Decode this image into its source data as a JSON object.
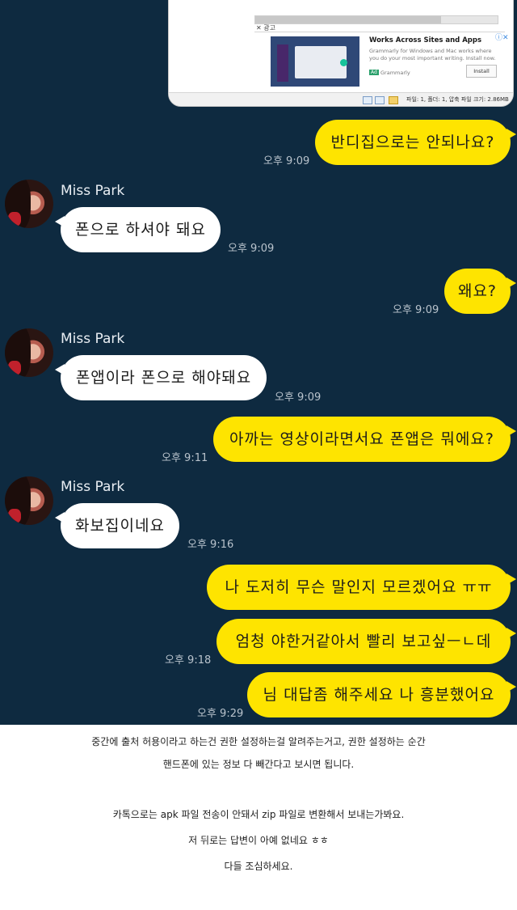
{
  "screenshot_window": {
    "ad_close_label": "✕ 광고",
    "ad_title": "Works Across Sites and Apps",
    "ad_info_icon": "info-close-icon",
    "ad_desc": "Grammarly for Windows and Mac works where you do your most important writing. Install now.",
    "ad_badge": "Ad",
    "ad_brand": "Grammarly",
    "ad_button": "Install",
    "status_text": "파일: 1, 폴더: 1, 압축 파일 크기: 2.86MB"
  },
  "chat": {
    "messages": [
      {
        "text": "반디집으로는 안되나요?",
        "time": "오후 9:09"
      },
      {
        "sender": "Miss Park",
        "text": "폰으로 하셔야 돼요",
        "time": "오후 9:09"
      },
      {
        "text": "왜요?",
        "time": "오후 9:09"
      },
      {
        "sender": "Miss Park",
        "text": "폰앱이라 폰으로 해야돼요",
        "time": "오후 9:09"
      },
      {
        "text": "아까는 영상이라면서요 폰앱은 뭐에요?",
        "time": "오후 9:11"
      },
      {
        "sender": "Miss Park",
        "text": "화보집이네요",
        "time": "오후 9:16"
      },
      {
        "text": "나 도저히 무슨 말인지 모르겠어요 ㅠㅠ"
      },
      {
        "text": "엄청 야한거같아서 빨리 보고싶ㅡㄴ데",
        "time": "오후 9:18"
      },
      {
        "text": "님 대답좀 해주세요 나 흥분했어요",
        "time": "오후 9:29"
      }
    ]
  },
  "caption": {
    "line1": "중간에 출처 허용이라고 하는건 권한 설정하는걸 알려주는거고, 권한 설정하는 순간",
    "line2": "핸드폰에 있는 정보 다 빼간다고 보시면 됩니다.",
    "line3": "카톡으로는 apk 파일 전송이 안돼서 zip 파일로 변환해서 보내는가봐요.",
    "line4": "저 뒤로는 답변이 아예 없네요 ㅎㅎ",
    "line5": "다들 조심하세요."
  }
}
